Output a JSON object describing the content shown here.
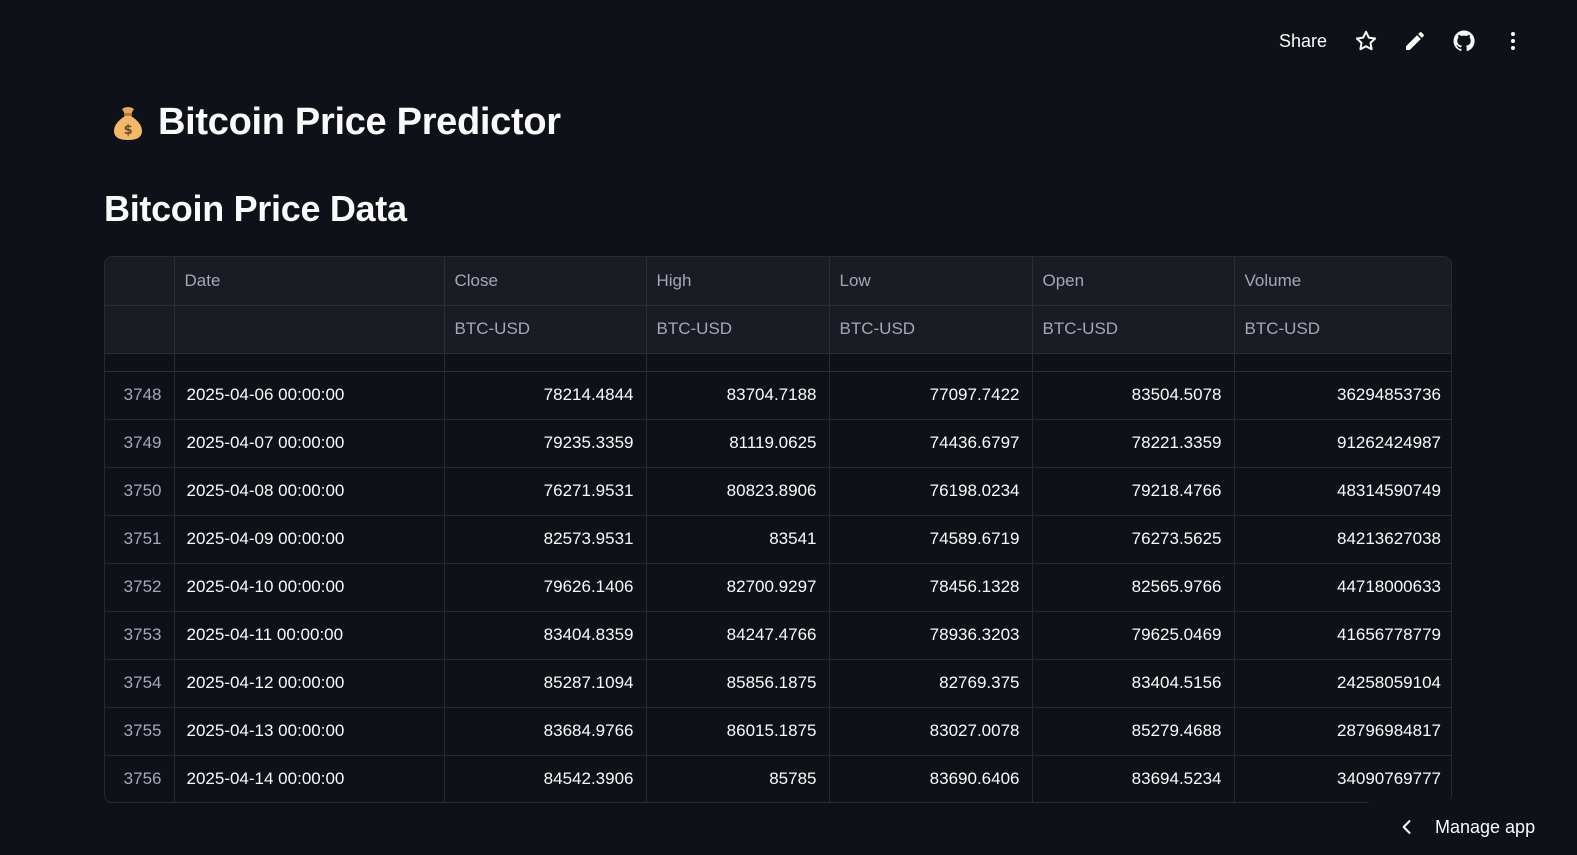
{
  "toolbar": {
    "share_label": "Share",
    "icons": [
      "star-icon",
      "pencil-icon",
      "github-icon",
      "kebab-menu-icon"
    ]
  },
  "page": {
    "title": "Bitcoin Price Predictor",
    "title_icon": "money-bag-emoji",
    "subtitle": "Bitcoin Price Data"
  },
  "table": {
    "columns": [
      "Date",
      "Close",
      "High",
      "Low",
      "Open",
      "Volume"
    ],
    "subheaders": [
      "",
      "BTC-USD",
      "BTC-USD",
      "BTC-USD",
      "BTC-USD",
      "BTC-USD"
    ],
    "rows": [
      {
        "idx": "3748",
        "date": "2025-04-06 00:00:00",
        "close": "78214.4844",
        "high": "83704.7188",
        "low": "77097.7422",
        "open": "83504.5078",
        "volume": "36294853736"
      },
      {
        "idx": "3749",
        "date": "2025-04-07 00:00:00",
        "close": "79235.3359",
        "high": "81119.0625",
        "low": "74436.6797",
        "open": "78221.3359",
        "volume": "91262424987"
      },
      {
        "idx": "3750",
        "date": "2025-04-08 00:00:00",
        "close": "76271.9531",
        "high": "80823.8906",
        "low": "76198.0234",
        "open": "79218.4766",
        "volume": "48314590749"
      },
      {
        "idx": "3751",
        "date": "2025-04-09 00:00:00",
        "close": "82573.9531",
        "high": "83541",
        "low": "74589.6719",
        "open": "76273.5625",
        "volume": "84213627038"
      },
      {
        "idx": "3752",
        "date": "2025-04-10 00:00:00",
        "close": "79626.1406",
        "high": "82700.9297",
        "low": "78456.1328",
        "open": "82565.9766",
        "volume": "44718000633"
      },
      {
        "idx": "3753",
        "date": "2025-04-11 00:00:00",
        "close": "83404.8359",
        "high": "84247.4766",
        "low": "78936.3203",
        "open": "79625.0469",
        "volume": "41656778779"
      },
      {
        "idx": "3754",
        "date": "2025-04-12 00:00:00",
        "close": "85287.1094",
        "high": "85856.1875",
        "low": "82769.375",
        "open": "83404.5156",
        "volume": "24258059104"
      },
      {
        "idx": "3755",
        "date": "2025-04-13 00:00:00",
        "close": "83684.9766",
        "high": "86015.1875",
        "low": "83027.0078",
        "open": "85279.4688",
        "volume": "28796984817"
      },
      {
        "idx": "3756",
        "date": "2025-04-14 00:00:00",
        "close": "84542.3906",
        "high": "85785",
        "low": "83690.6406",
        "open": "83694.5234",
        "volume": "34090769777"
      }
    ]
  },
  "footer": {
    "manage_label": "Manage app"
  }
}
